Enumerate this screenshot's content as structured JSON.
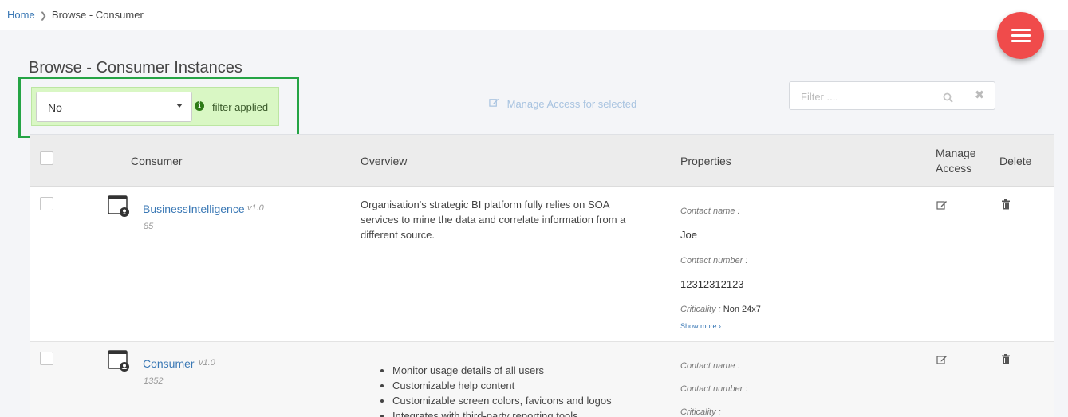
{
  "breadcrumb": {
    "home": "Home",
    "current": "Browse - Consumer"
  },
  "page": {
    "title": "Browse - Consumer Instances"
  },
  "filter": {
    "selected": "No",
    "status": "filter applied"
  },
  "toolbar": {
    "manage_access": "Manage Access for selected"
  },
  "search": {
    "placeholder": "Filter ...."
  },
  "table": {
    "headers": {
      "consumer": "Consumer",
      "overview": "Overview",
      "properties": "Properties",
      "manage_access_1": "Manage",
      "manage_access_2": "Access",
      "delete": "Delete"
    },
    "rows": [
      {
        "name": "BusinessIntelligence",
        "version": "v1.0",
        "id": "85",
        "overview": [
          "Organisation's strategic BI platform fully relies on SOA",
          "services to mine the data and correlate information from a",
          "different source."
        ],
        "contact_name_label": "Contact name :",
        "contact_name": "Joe",
        "contact_number_label": "Contact number :",
        "contact_number": "12312312123",
        "criticality_label": "Criticality :",
        "criticality": "Non 24x7",
        "show_more": "Show more ›"
      },
      {
        "name": "Consumer",
        "version": "v1.0",
        "id": "1352",
        "overview_items": [
          "Monitor usage details of all users",
          "Customizable help content",
          "Customizable screen colors, favicons and logos",
          "Integrates with third-party reporting tools"
        ],
        "contact_name_label": "Contact name :",
        "contact_number_label": "Contact number :",
        "criticality_label": "Criticality :"
      }
    ]
  },
  "colors": {
    "link": "#3a78b5",
    "fab": "#f04b4b",
    "highlight": "#25a445",
    "filter_bg": "#d9f7c4"
  },
  "icons": [
    "chevron-right-icon",
    "menu-icon",
    "caret-down-icon",
    "info-icon",
    "edit-icon",
    "search-icon",
    "close-icon",
    "consumer-app-icon",
    "trash-icon"
  ]
}
